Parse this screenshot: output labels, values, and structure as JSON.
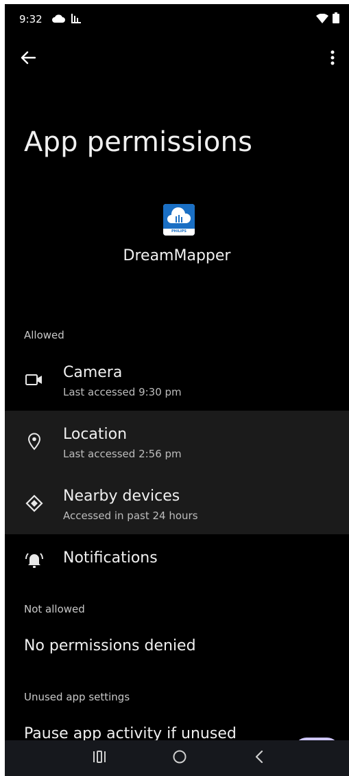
{
  "status_bar": {
    "time": "9:32",
    "left_icons": [
      "cloud-icon",
      "chart-icon"
    ],
    "right_icons": [
      "wifi-icon",
      "battery-icon"
    ]
  },
  "app_bar": {
    "back_icon": "arrow-left-icon",
    "menu_icon": "more-vert-icon"
  },
  "page": {
    "title": "App permissions",
    "app_name": "DreamMapper",
    "app_icon_text": "PHILIPS"
  },
  "sections": {
    "allowed_label": "Allowed",
    "not_allowed_label": "Not allowed",
    "unused_label": "Unused app settings"
  },
  "allowed": [
    {
      "icon": "camera-icon",
      "title": "Camera",
      "subtitle": "Last accessed 9:30 pm"
    },
    {
      "icon": "location-icon",
      "title": "Location",
      "subtitle": "Last accessed 2:56 pm"
    },
    {
      "icon": "nearby-devices-icon",
      "title": "Nearby devices",
      "subtitle": "Accessed in past 24 hours"
    },
    {
      "icon": "notifications-icon",
      "title": "Notifications",
      "subtitle": ""
    }
  ],
  "not_allowed": {
    "text": "No permissions denied"
  },
  "unused": {
    "pause_label": "Pause app activity if unused"
  },
  "nav_bar": [
    "recents-icon",
    "home-icon",
    "back-icon"
  ],
  "colors": {
    "background": "#000000",
    "highlight_row": "#1b1b1b",
    "toggle": "#cfc7ff",
    "app_icon_blue": "#1a6fc4"
  }
}
